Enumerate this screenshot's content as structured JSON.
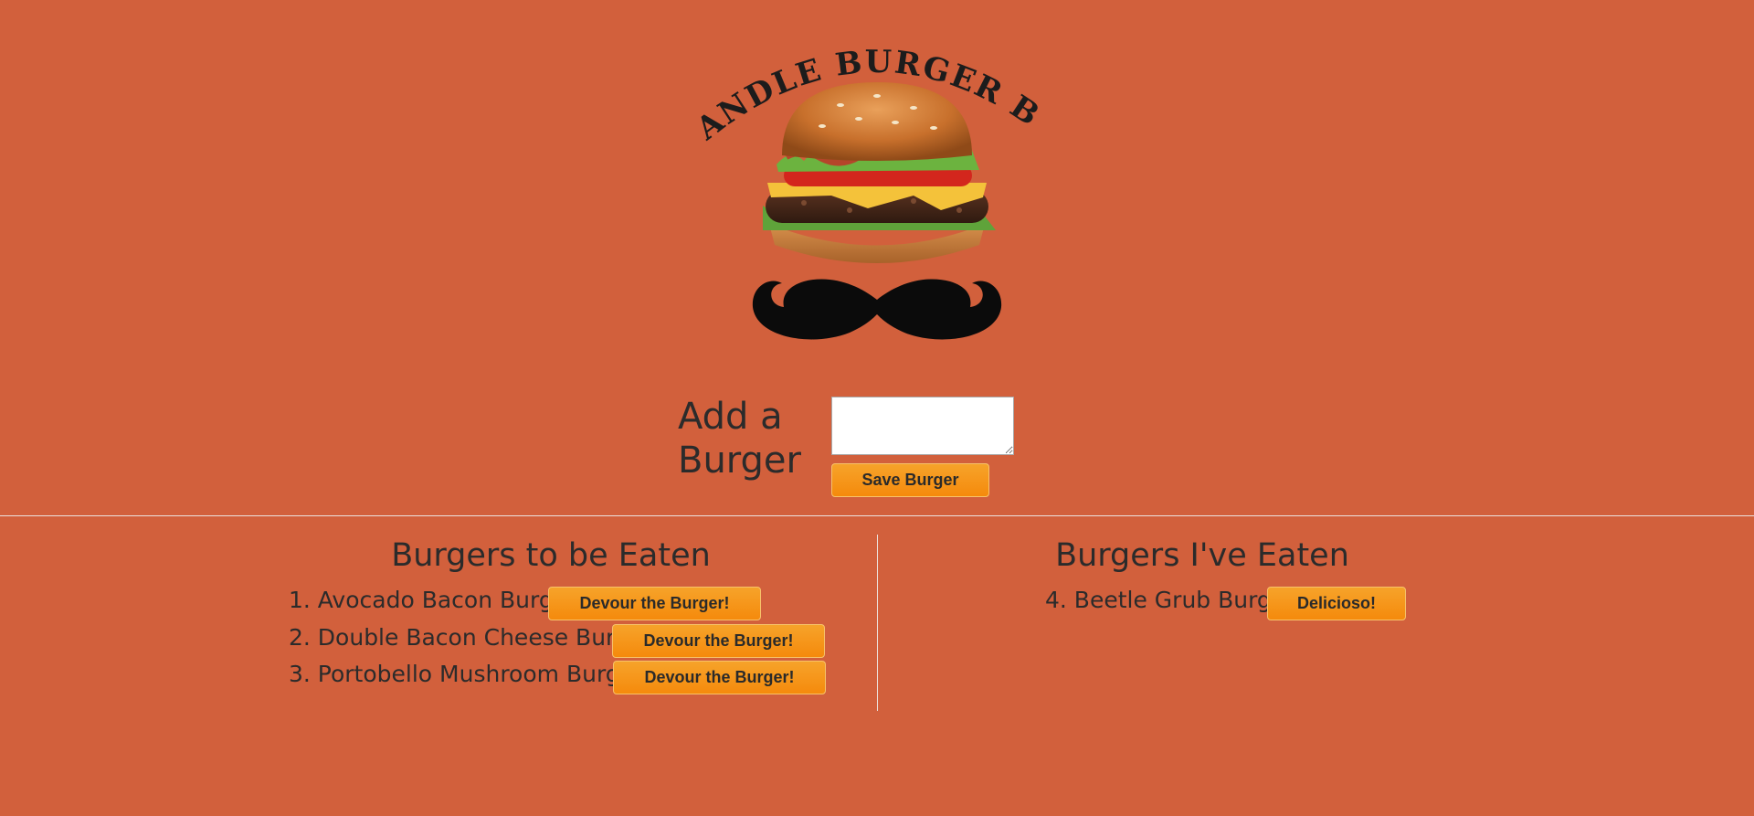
{
  "logo": {
    "title_text": "HANDLE BURGER BAR",
    "alt": "Handle Burger Bar logo with burger and mustache"
  },
  "add_form": {
    "label": "Add a Burger",
    "textarea_value": "",
    "save_button": "Save Burger"
  },
  "to_eat": {
    "heading": "Burgers to be Eaten",
    "items": [
      {
        "text": "1. Avocado Bacon Burger",
        "button": "Devour the Burger!"
      },
      {
        "text": "2. Double Bacon Cheese Burger",
        "button": "Devour the Burger!"
      },
      {
        "text": "3. Portobello Mushroom Burger",
        "button": "Devour the Burger!"
      }
    ]
  },
  "eaten": {
    "heading": "Burgers I've Eaten",
    "items": [
      {
        "text": "4. Beetle Grub Burger",
        "button": "Delicioso!"
      }
    ]
  },
  "colors": {
    "background": "#d2603c",
    "button_top": "#f6a32a",
    "button_bottom": "#f58a0c",
    "text": "#2b2b2b"
  }
}
